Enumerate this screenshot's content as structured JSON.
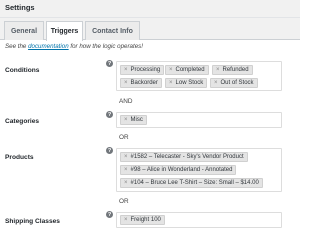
{
  "header": {
    "title": "Settings"
  },
  "tabs": [
    {
      "label": "General"
    },
    {
      "label": "Triggers"
    },
    {
      "label": "Contact Info"
    }
  ],
  "doc_note": {
    "prefix": "See the ",
    "link": "documentation",
    "suffix": " for how the logic operates!"
  },
  "rows": {
    "conditions": {
      "label": "Conditions",
      "chips": [
        "Processing",
        "Completed",
        "Refunded",
        "Backorder",
        "Low Stock",
        "Out of Stock"
      ]
    },
    "categories": {
      "label": "Categories",
      "chips": [
        "Misc"
      ]
    },
    "products": {
      "label": "Products",
      "chips": [
        "#1582 – Telecaster - Sky's Vendor Product",
        "#98 – Alice in Wonderland - Annotated",
        "#104 – Bruce Lee T-Shirt – Size: Small – $14.00"
      ]
    },
    "shipping": {
      "label": "Shipping Classes",
      "chips": [
        "Freight 100"
      ]
    }
  },
  "connectors": {
    "and": "AND",
    "or": "OR"
  },
  "icons": {
    "help": "help-icon",
    "remove": "remove-icon"
  },
  "remove_glyph": "×",
  "help_glyph": "?",
  "colors": {
    "link": "#0073aa",
    "chip_bg": "#e4e4e4",
    "header_bg": "#f1f1f1"
  }
}
